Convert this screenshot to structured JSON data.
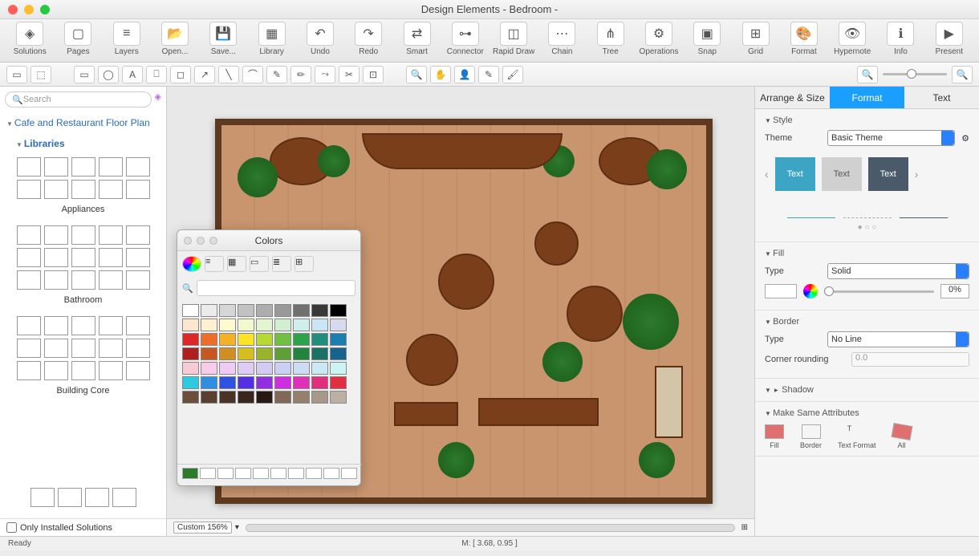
{
  "window": {
    "title": "Design Elements - Bedroom -"
  },
  "toolbar": [
    {
      "label": "Solutions",
      "icon": "◈"
    },
    {
      "label": "Pages",
      "icon": "▢"
    },
    {
      "label": "Layers",
      "icon": "≡"
    },
    {
      "label": "Open...",
      "icon": "📂"
    },
    {
      "label": "Save...",
      "icon": "💾"
    },
    {
      "label": "Library",
      "icon": "▦"
    },
    {
      "label": "Undo",
      "icon": "↶"
    },
    {
      "label": "Redo",
      "icon": "↷"
    },
    {
      "label": "Smart",
      "icon": "⇄"
    },
    {
      "label": "Connector",
      "icon": "⊶"
    },
    {
      "label": "Rapid Draw",
      "icon": "◫"
    },
    {
      "label": "Chain",
      "icon": "⋯"
    },
    {
      "label": "Tree",
      "icon": "⋔"
    },
    {
      "label": "Operations",
      "icon": "⚙"
    },
    {
      "label": "Snap",
      "icon": "▣"
    },
    {
      "label": "Grid",
      "icon": "⊞"
    },
    {
      "label": "Format",
      "icon": "🎨"
    },
    {
      "label": "Hypernote",
      "icon": "👁"
    },
    {
      "label": "Info",
      "icon": "ℹ"
    },
    {
      "label": "Present",
      "icon": "▶"
    }
  ],
  "sidebar_left": {
    "search_placeholder": "Search",
    "section": "Cafe and Restaurant Floor Plan",
    "libraries_label": "Libraries",
    "groups": [
      {
        "title": "Appliances",
        "cells": 10
      },
      {
        "title": "Bathroom",
        "cells": 15
      },
      {
        "title": "Building Core",
        "cells": 15
      }
    ],
    "only_installed": "Only Installed Solutions"
  },
  "canvas": {
    "zoom": "Custom 156%"
  },
  "colors_popup": {
    "title": "Colors",
    "palette": [
      "#ffffff",
      "#ebebeb",
      "#d6d6d6",
      "#c2c2c2",
      "#adadad",
      "#999999",
      "#707070",
      "#383838",
      "#000000",
      "#fbe7cd",
      "#fdf1cf",
      "#fefacf",
      "#f2f9cf",
      "#e3f4d0",
      "#d2efd2",
      "#d0eeeb",
      "#cae5f4",
      "#d7d9ef",
      "#dc2828",
      "#ec6e28",
      "#f4b128",
      "#fbe428",
      "#b7d934",
      "#72c043",
      "#2ba24b",
      "#1f8e7b",
      "#1b7db0",
      "#b01f1f",
      "#c55820",
      "#d08f20",
      "#d5bf20",
      "#99b42a",
      "#5e9f37",
      "#22843d",
      "#197264",
      "#15648e",
      "#f7cbd5",
      "#f7cbea",
      "#eecbf4",
      "#e0cbf4",
      "#d3cbf4",
      "#cbcff4",
      "#cbdcf4",
      "#cbe9f4",
      "#cbf4f2",
      "#2fcae0",
      "#2f8ee0",
      "#2f52e0",
      "#552fe0",
      "#912fe0",
      "#cd2fe0",
      "#e02fb9",
      "#e02f7d",
      "#e02f41",
      "#6b4f3a",
      "#5a4030",
      "#493226",
      "#38251d",
      "#271813",
      "#826856",
      "#95806f",
      "#a8988a",
      "#bbb0a4"
    ]
  },
  "right": {
    "tabs": [
      "Arrange & Size",
      "Format",
      "Text"
    ],
    "active_tab": "Format",
    "style": {
      "section": "Style",
      "theme_label": "Theme",
      "theme_value": "Basic Theme",
      "swatch_text": "Text"
    },
    "fill": {
      "section": "Fill",
      "type_label": "Type",
      "type_value": "Solid",
      "opacity": "0%"
    },
    "border": {
      "section": "Border",
      "type_label": "Type",
      "type_value": "No Line",
      "corner_label": "Corner rounding",
      "corner_value": "0.0"
    },
    "shadow": {
      "section": "Shadow"
    },
    "same": {
      "section": "Make Same Attributes",
      "items": [
        "Fill",
        "Border",
        "Text Format",
        "All"
      ]
    }
  },
  "status": {
    "ready": "Ready",
    "mouse": "M: [ 3.68, 0.95 ]"
  }
}
